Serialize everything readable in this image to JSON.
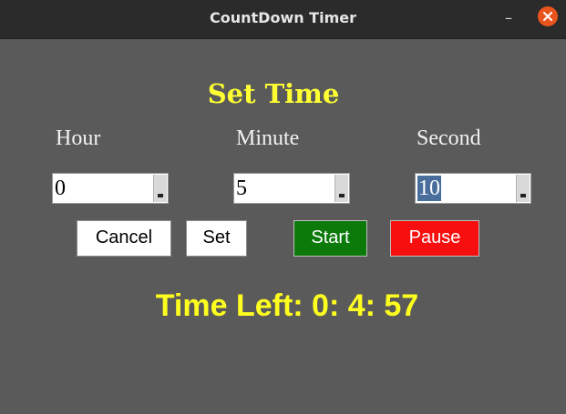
{
  "window": {
    "title": "CountDown Timer",
    "minimize_glyph": "–",
    "icons": {
      "minimize": "minimize-icon",
      "close": "close-icon"
    },
    "colors": {
      "close_button": "#e9541d"
    }
  },
  "form": {
    "heading": "Set Time",
    "fields": [
      {
        "label": "Hour",
        "value": "0"
      },
      {
        "label": "Minute",
        "value": "5"
      },
      {
        "label": "Second",
        "value": "10"
      }
    ]
  },
  "buttons": {
    "cancel": "Cancel",
    "set": "Set",
    "start": "Start",
    "pause": "Pause"
  },
  "status": {
    "time_left": "Time Left: 0: 4: 57"
  },
  "colors": {
    "background": "#5a5a5a",
    "heading": "#ffff33",
    "start": "#0b7a0b",
    "pause": "#f70f0f"
  }
}
